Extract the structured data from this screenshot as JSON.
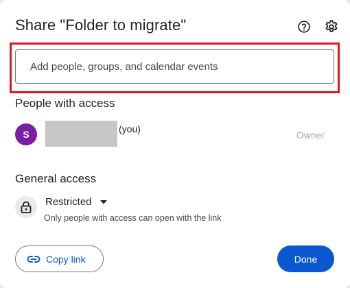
{
  "dialog": {
    "title": "Share \"Folder to migrate\"",
    "help_icon": "help-circle-icon",
    "settings_icon": "gear-icon"
  },
  "search": {
    "placeholder": "Add people, groups, and calendar events",
    "value": "",
    "highlight_color": "#e0161e"
  },
  "people": {
    "heading": "People with access",
    "members": [
      {
        "avatar_initial": "S",
        "avatar_color": "#7b1fa2",
        "suffix": "(you)",
        "role": "Owner"
      }
    ]
  },
  "general_access": {
    "heading": "General access",
    "icon": "lock-icon",
    "selected": "Restricted",
    "description": "Only people with access can open with the link"
  },
  "footer": {
    "copy_link_label": "Copy link",
    "copy_link_icon": "link-icon",
    "done_label": "Done",
    "accent_color": "#0b57d0"
  }
}
